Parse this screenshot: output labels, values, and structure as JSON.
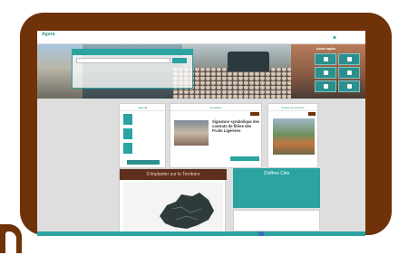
{
  "header": {
    "logo_title": "Agora",
    "logo_sub": "",
    "nav": [
      "",
      "",
      "",
      ""
    ]
  },
  "search": {
    "label": "",
    "placeholder": "",
    "note": ""
  },
  "quick_access": {
    "title": "Accès rapide",
    "tiles": [
      {
        "icon": "people-icon"
      },
      {
        "icon": "tools-icon"
      },
      {
        "icon": "chart-icon"
      },
      {
        "icon": "phone-icon"
      },
      {
        "icon": "map-icon"
      },
      {
        "icon": "document-icon"
      }
    ]
  },
  "agenda": {
    "title": "Agenda",
    "items": [
      {
        "text": ""
      },
      {
        "text": ""
      },
      {
        "text": ""
      }
    ],
    "more_label": ""
  },
  "actualites": {
    "title": "Actualités",
    "headline": "Signature symbolique des contrats de filière des Fruits Ligériens",
    "date": "",
    "more_label": ""
  },
  "projets": {
    "title": "Projets du territoire"
  },
  "map": {
    "title": "S'implanter sur le Territoire"
  },
  "chiffres": {
    "title": "Chiffres Clés",
    "stats": [
      "",
      "",
      "",
      ""
    ]
  },
  "lower": {
    "title": ""
  },
  "colors": {
    "teal": "#2aa3a1",
    "dark_teal": "#2d8f8d",
    "brown_frame": "#6f3209",
    "map_header": "#5d2f1c"
  }
}
